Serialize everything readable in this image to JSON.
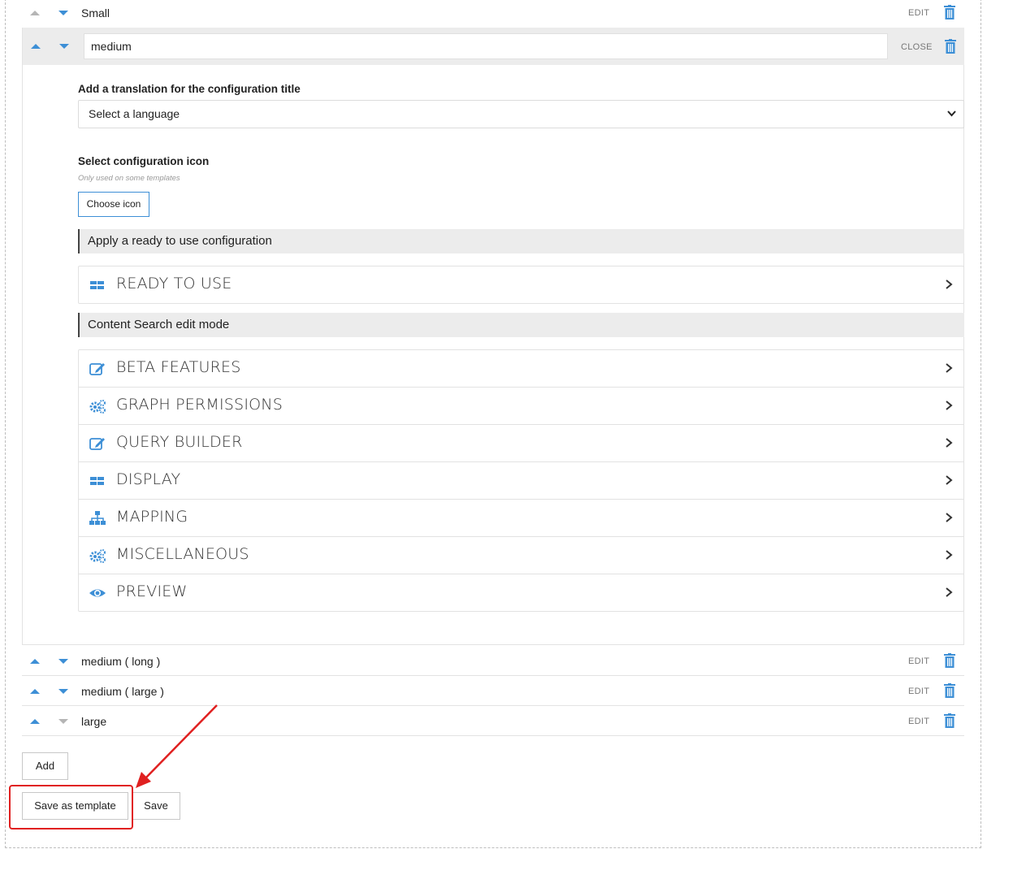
{
  "rows_top": [
    {
      "label": "Small",
      "action": "EDIT"
    }
  ],
  "expanded": {
    "name_value": "medium",
    "close_label": "CLOSE",
    "translation_label": "Add a translation for the configuration title",
    "language_select": "Select a language",
    "icon_label": "Select configuration icon",
    "icon_hint": "Only used on some templates",
    "choose_icon": "Choose icon",
    "section_ready": "Apply a ready to use configuration",
    "ready_items": [
      {
        "title": "READY TO USE",
        "icon": "grid-icon"
      }
    ],
    "section_edit": "Content Search edit mode",
    "edit_items": [
      {
        "title": "BETA FEATURES",
        "icon": "edit-icon"
      },
      {
        "title": "GRAPH PERMISSIONS",
        "icon": "cogs-icon"
      },
      {
        "title": "QUERY BUILDER",
        "icon": "edit-icon"
      },
      {
        "title": "DISPLAY",
        "icon": "grid-icon"
      },
      {
        "title": "MAPPING",
        "icon": "sitemap-icon"
      },
      {
        "title": "MISCELLANEOUS",
        "icon": "cogs-icon"
      },
      {
        "title": "PREVIEW",
        "icon": "eye-icon"
      }
    ]
  },
  "rows_bottom": [
    {
      "label": "medium ( long )",
      "action": "EDIT"
    },
    {
      "label": "medium ( large )",
      "action": "EDIT"
    },
    {
      "label": "large",
      "action": "EDIT"
    }
  ],
  "buttons": {
    "add": "Add",
    "save_as_template": "Save as template",
    "save": "Save"
  },
  "colors": {
    "accent": "#3d8fd6",
    "annotation": "#e02020",
    "header_bg": "#ececec"
  }
}
